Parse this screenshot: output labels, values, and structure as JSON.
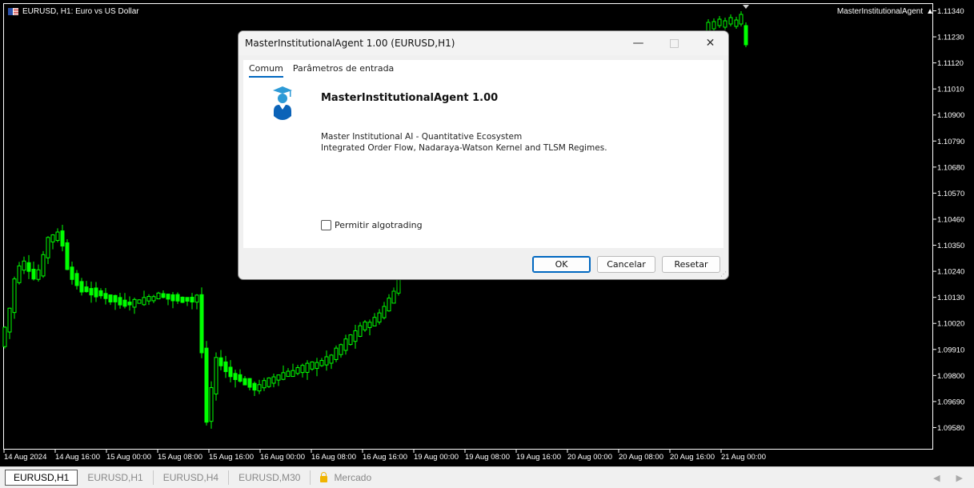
{
  "chart": {
    "title": "EURUSD, H1:  Euro vs US Dollar",
    "ea_name": "MasterInstitutionalAgent",
    "ea_icon": "graduation-cap-icon",
    "bull_color": "#00ff00",
    "price_labels": [
      "1.11340",
      "1.11230",
      "1.11120",
      "1.11010",
      "1.10900",
      "1.10790",
      "1.10680",
      "1.10570",
      "1.10460",
      "1.10350",
      "1.10240",
      "1.10130",
      "1.10020",
      "1.09910",
      "1.09800",
      "1.09690",
      "1.09580"
    ],
    "time_labels": [
      "14 Aug 2024",
      "14 Aug 16:00",
      "15 Aug 00:00",
      "15 Aug 08:00",
      "15 Aug 16:00",
      "16 Aug 00:00",
      "16 Aug 08:00",
      "16 Aug 16:00",
      "19 Aug 00:00",
      "19 Aug 08:00",
      "19 Aug 16:00",
      "20 Aug 00:00",
      "20 Aug 08:00",
      "20 Aug 16:00",
      "21 Aug 00:00"
    ]
  },
  "dialog": {
    "title": "MasterInstitutionalAgent 1.00 (EURUSD,H1)",
    "tabs": [
      "Comum",
      "Parâmetros de entrada"
    ],
    "program_name": "MasterInstitutionalAgent 1.00",
    "description_line1": "Master Institutional AI - Quantitative Ecosystem",
    "description_line2": "Integrated Order Flow, Nadaraya-Watson Kernel and TLSM Regimes.",
    "algotrading_label": "Permitir algotrading",
    "algotrading_checked": false,
    "ok_label": "OK",
    "cancel_label": "Cancelar",
    "reset_label": "Resetar",
    "accent_color": "#0067c0"
  },
  "tabbar": {
    "tabs": [
      "EURUSD,H1",
      "EURUSD,H1",
      "EURUSD,H4",
      "EURUSD,M30"
    ],
    "market_label": "Mercado"
  }
}
